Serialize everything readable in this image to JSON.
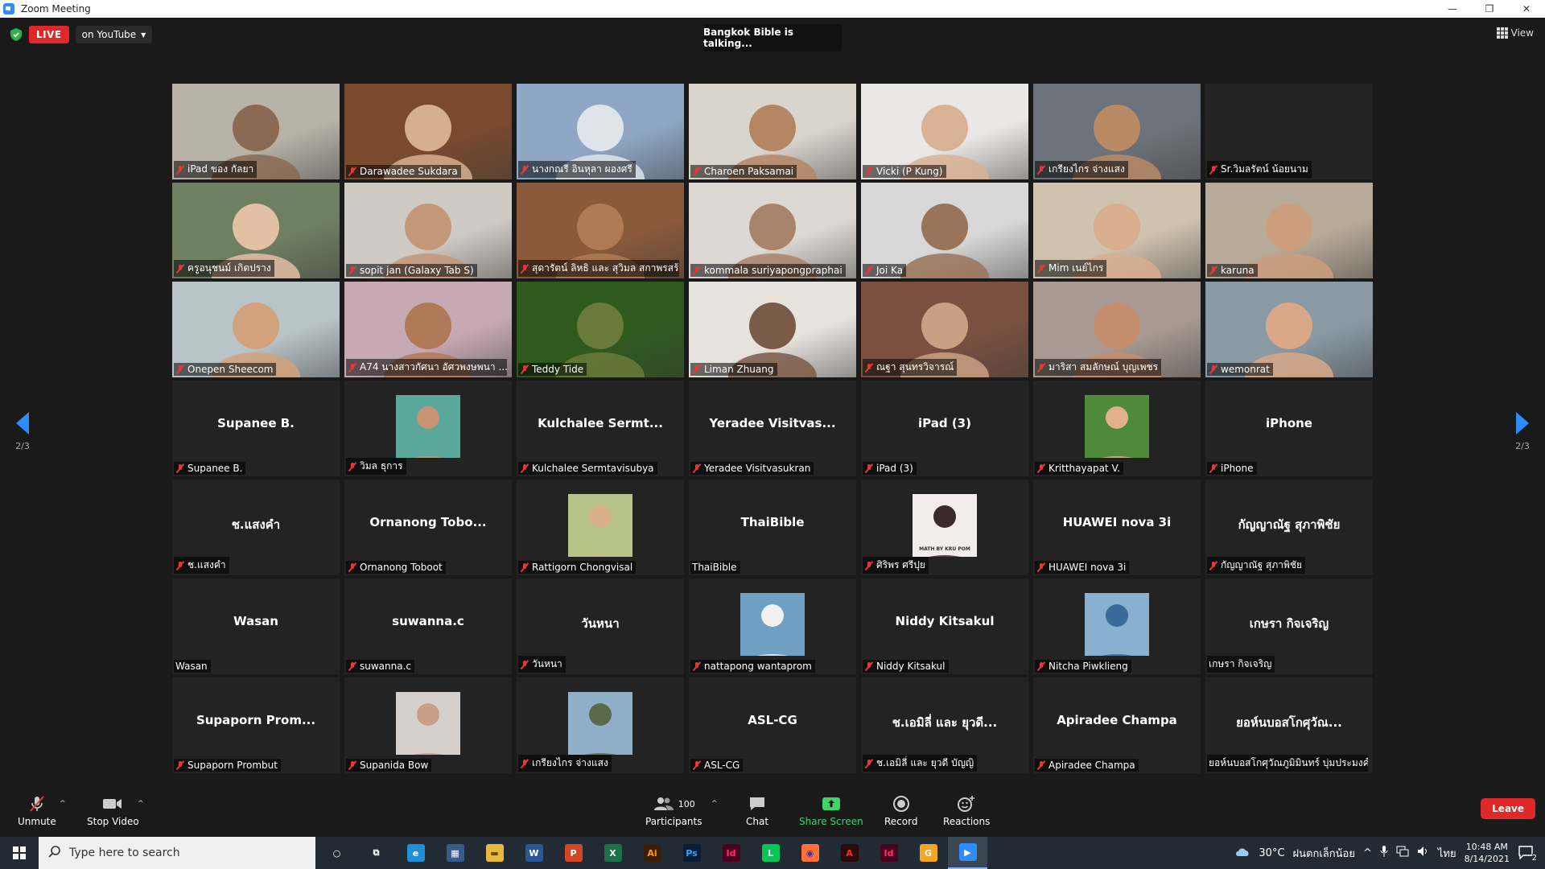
{
  "window": {
    "title": "Zoom Meeting",
    "minimize": "—",
    "restore": "❐",
    "close": "✕"
  },
  "header": {
    "live_label": "LIVE",
    "stream_target": "on YouTube",
    "talking_indicator": "Bangkok Bible is talking...",
    "view_label": "View"
  },
  "pagination": {
    "left_page": "2/3",
    "right_page": "2/3"
  },
  "participants": [
    {
      "label": "iPad ของ กัลยา",
      "muted": true,
      "kind": "video",
      "bg": "#b8b2a8",
      "skin": "#8a6a52"
    },
    {
      "label": "Darawadee Sukdara",
      "muted": true,
      "kind": "video",
      "bg": "#7a4a2e",
      "skin": "#d6b08e"
    },
    {
      "label": "นางกณรี อินหุลา ผองศรี",
      "muted": true,
      "kind": "video",
      "bg": "#8fa7c4",
      "skin": "#dfe4ea"
    },
    {
      "label": "Charoen Paksamai",
      "muted": true,
      "kind": "video",
      "bg": "#d9d4cc",
      "skin": "#b58664"
    },
    {
      "label": "Vicki (P Kung)",
      "muted": true,
      "kind": "video",
      "bg": "#eae8e6",
      "skin": "#d9b295"
    },
    {
      "label": "เกรียงไกร จ่างแสง",
      "muted": true,
      "kind": "video",
      "bg": "#6d737a",
      "skin": "#b88a66"
    },
    {
      "label": "Sr.วิมลรัตน์ น้อยนาม",
      "muted": true,
      "kind": "name-only",
      "big": ""
    },
    {
      "label": "ครูอนุชนม์ เกิดปราง",
      "muted": true,
      "kind": "video",
      "bg": "#6f7f62",
      "skin": "#e2c0a4"
    },
    {
      "label": "sopit jan (Galaxy Tab S)",
      "muted": true,
      "kind": "video",
      "bg": "#cfcac4",
      "skin": "#c49878"
    },
    {
      "label": "สุดารัตน์ ลิหธิ และ สุวิมล สกาพรสร้...",
      "muted": true,
      "kind": "video",
      "bg": "#8a5a3a",
      "skin": "#b07a56"
    },
    {
      "label": "kommala suriyapongpraphai",
      "muted": true,
      "kind": "video",
      "bg": "#dcd8d4",
      "skin": "#a8846a"
    },
    {
      "label": "Joi Ka",
      "muted": true,
      "kind": "video",
      "bg": "#d8d8d8",
      "skin": "#9a7458"
    },
    {
      "label": "Mim เนย์ไกร",
      "muted": true,
      "kind": "video",
      "bg": "#cfc2ae",
      "skin": "#d8ae8e"
    },
    {
      "label": "karuna",
      "muted": true,
      "kind": "video",
      "bg": "#b8aa98",
      "skin": "#cc9e7e"
    },
    {
      "label": "Onepen Sheecom",
      "muted": true,
      "kind": "video",
      "bg": "#b9c4c8",
      "skin": "#d2a27c"
    },
    {
      "label": "A74 นางสาวกัศนา อัศวพงษพนา ...",
      "muted": true,
      "kind": "video",
      "bg": "#c7a9b4",
      "skin": "#b07a58"
    },
    {
      "label": "Teddy Tide",
      "muted": true,
      "kind": "video",
      "bg": "#2f5a1e",
      "skin": "#6a7a3a"
    },
    {
      "label": "Liman Zhuang",
      "muted": true,
      "kind": "video",
      "bg": "#e6e2dc",
      "skin": "#7a5a48"
    },
    {
      "label": "ณฐา สุนทรวิจารณ์",
      "muted": true,
      "kind": "video",
      "bg": "#7a5040",
      "skin": "#caa084"
    },
    {
      "label": "มาริสา สมลักษณ์ บุญเพชร",
      "muted": true,
      "kind": "video",
      "bg": "#a89a92",
      "skin": "#c48e6e"
    },
    {
      "label": "wemonrat",
      "muted": true,
      "kind": "video",
      "bg": "#8a9aa4",
      "skin": "#d8a888"
    },
    {
      "label": "Supanee B.",
      "muted": true,
      "kind": "name-only",
      "big": "Supanee B."
    },
    {
      "label": "วิมล ธุการ",
      "muted": true,
      "kind": "thumb",
      "bg": "#5aa89a",
      "skin": "#c99474"
    },
    {
      "label": "Kulchalee Sermtavisubya",
      "muted": true,
      "kind": "name-only",
      "big": "Kulchalee Sermt..."
    },
    {
      "label": "Yeradee Visitvasukran",
      "muted": true,
      "kind": "name-only",
      "big": "Yeradee Visitvas..."
    },
    {
      "label": "iPad (3)",
      "muted": true,
      "kind": "name-only",
      "big": "iPad (3)"
    },
    {
      "label": "Kritthayapat V.",
      "muted": true,
      "kind": "thumb",
      "bg": "#4f8a3a",
      "skin": "#e0b08a"
    },
    {
      "label": "iPhone",
      "muted": true,
      "kind": "name-only",
      "big": "iPhone"
    },
    {
      "label": "ช.แสงคำ",
      "muted": true,
      "kind": "name-only",
      "big": "ช.แสงคำ"
    },
    {
      "label": "Ornanong Toboot",
      "muted": true,
      "kind": "name-only",
      "big": "Ornanong Tobo..."
    },
    {
      "label": "Rattigorn Chongvisal",
      "muted": true,
      "kind": "thumb",
      "bg": "#b6c48a",
      "skin": "#d8b08c"
    },
    {
      "label": "ThaiBible",
      "muted": false,
      "kind": "name-only",
      "big": "ThaiBible"
    },
    {
      "label": "ศิริพร ศรีปุย",
      "muted": true,
      "kind": "thumb",
      "bg": "#f2ecec",
      "skin": "#3a2a2a",
      "caption": "MATH BY KRU POM"
    },
    {
      "label": "HUAWEI nova 3i",
      "muted": true,
      "kind": "name-only",
      "big": "HUAWEI nova 3i"
    },
    {
      "label": "กัญญาณัฐ สุภาพิชัย",
      "muted": true,
      "kind": "name-only",
      "big": "กัญญาณัฐ สุภาพิชัย"
    },
    {
      "label": "Wasan",
      "muted": false,
      "kind": "name-only",
      "big": "Wasan"
    },
    {
      "label": "suwanna.c",
      "muted": true,
      "kind": "name-only",
      "big": "suwanna.c"
    },
    {
      "label": "วันหนา",
      "muted": true,
      "kind": "name-only",
      "big": "วันหนา"
    },
    {
      "label": "nattapong wantaprom",
      "muted": true,
      "kind": "thumb",
      "bg": "#6fa0c4",
      "skin": "#f0f0f0"
    },
    {
      "label": "Niddy Kitsakul",
      "muted": true,
      "kind": "name-only",
      "big": "Niddy Kitsakul"
    },
    {
      "label": "Nitcha Piwklieng",
      "muted": true,
      "kind": "thumb",
      "bg": "#8ab0d0",
      "skin": "#3a6a9a"
    },
    {
      "label": "เกษรา กิจเจริญ",
      "muted": false,
      "kind": "name-only",
      "big": "เกษรา กิจเจริญ"
    },
    {
      "label": "Supaporn Prombut",
      "muted": true,
      "kind": "name-only",
      "big": "Supaporn Prom..."
    },
    {
      "label": "Supanida Bow",
      "muted": true,
      "kind": "thumb",
      "bg": "#d6d0cc",
      "skin": "#c8a08a"
    },
    {
      "label": "เกรียงไกร จ่างแสง",
      "muted": true,
      "kind": "thumb",
      "bg": "#8fb0c8",
      "skin": "#5a6a4a"
    },
    {
      "label": "ASL-CG",
      "muted": true,
      "kind": "name-only",
      "big": "ASL-CG"
    },
    {
      "label": "ช.เอมิลี่ และ ยุวดี บัญญิ",
      "muted": true,
      "kind": "name-only",
      "big": "ช.เอมิลี่ และ ยุวดี..."
    },
    {
      "label": "Apiradee Champa",
      "muted": true,
      "kind": "name-only",
      "big": "Apiradee Champa"
    },
    {
      "label": "ยอห์นบอสโกศุวัณภูมิมินทร์ บุ่มประมงค์",
      "muted": false,
      "kind": "name-only",
      "big": "ยอห์นบอสโกศุวัณ..."
    }
  ],
  "toolbar": {
    "unmute": "Unmute",
    "stop_video": "Stop Video",
    "participants": "Participants",
    "participants_count": "100",
    "chat": "Chat",
    "share_screen": "Share Screen",
    "record": "Record",
    "reactions": "Reactions",
    "leave": "Leave"
  },
  "taskbar": {
    "search_placeholder": "Type here to search",
    "apps": [
      {
        "name": "cortana-icon",
        "glyph": "○",
        "color": "transparent",
        "fg": "#ffffff"
      },
      {
        "name": "task-view-icon",
        "glyph": "⧉",
        "color": "transparent",
        "fg": "#ffffff"
      },
      {
        "name": "edge-icon",
        "glyph": "e",
        "color": "#1f8fd6",
        "fg": "#ffffff"
      },
      {
        "name": "calculator-icon",
        "glyph": "▦",
        "color": "#3a5a8a",
        "fg": "#ffffff"
      },
      {
        "name": "file-explorer-icon",
        "glyph": "▬",
        "color": "#e8b93a",
        "fg": "#6a4a10"
      },
      {
        "name": "word-icon",
        "glyph": "W",
        "color": "#2b5797",
        "fg": "#ffffff"
      },
      {
        "name": "powerpoint-icon",
        "glyph": "P",
        "color": "#d24726",
        "fg": "#ffffff"
      },
      {
        "name": "excel-icon",
        "glyph": "X",
        "color": "#1e7145",
        "fg": "#ffffff"
      },
      {
        "name": "illustrator-icon",
        "glyph": "Ai",
        "color": "#3a1e08",
        "fg": "#ff9a00"
      },
      {
        "name": "photoshop-icon",
        "glyph": "Ps",
        "color": "#0a1e38",
        "fg": "#31a8ff"
      },
      {
        "name": "indesign-icon",
        "glyph": "Id",
        "color": "#49021f",
        "fg": "#ff3366"
      },
      {
        "name": "line-icon",
        "glyph": "L",
        "color": "#06c755",
        "fg": "#ffffff"
      },
      {
        "name": "firefox-icon",
        "glyph": "◉",
        "color": "#ff7139",
        "fg": "#5a2a8a"
      },
      {
        "name": "acrobat-icon",
        "glyph": "A",
        "color": "#2a0a0a",
        "fg": "#ff2a2a"
      },
      {
        "name": "indesign-alt-icon",
        "glyph": "Id",
        "color": "#49021f",
        "fg": "#ff3366"
      },
      {
        "name": "grammarly-icon",
        "glyph": "G",
        "color": "#f5a623",
        "fg": "#ffffff"
      },
      {
        "name": "zoom-taskbar-icon",
        "glyph": "▶",
        "color": "#2d8cff",
        "fg": "#ffffff",
        "active": true
      }
    ],
    "weather": "30°C",
    "location": "ฝนตกเล็กน้อย",
    "language": "ไทย",
    "time": "10:48 AM",
    "date": "8/14/2021",
    "notification_count": "2"
  },
  "colors": {
    "accent": "#2d8cff",
    "live_red": "#e02828",
    "share_green": "#3fd36a",
    "tile_bg": "#232323",
    "app_bg": "#1a1a1a"
  }
}
